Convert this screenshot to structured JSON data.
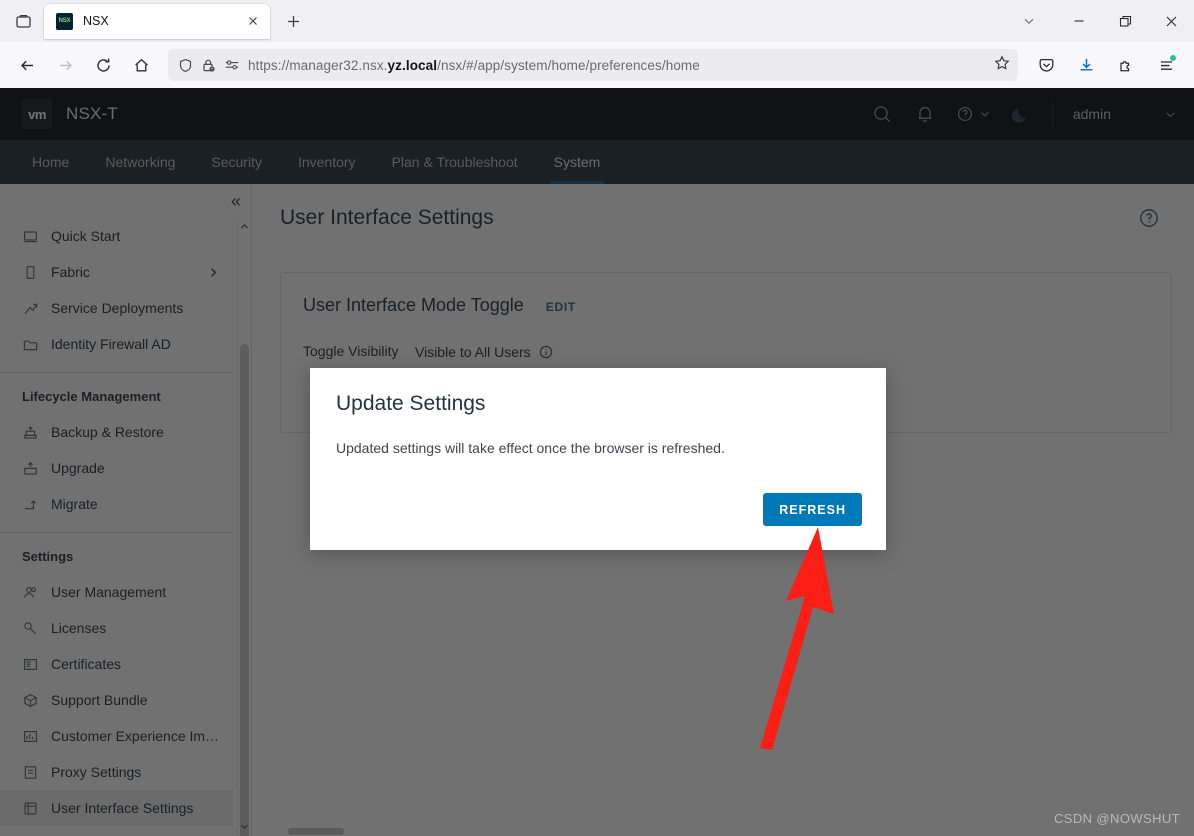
{
  "browser": {
    "tab": {
      "title": "NSX",
      "favicon_text": "NSX"
    },
    "url": {
      "prefix": "https://manager32.nsx.",
      "emphasis": "yz.local",
      "suffix": "/nsx/#/app/system/home/preferences/home"
    },
    "toolbar_icons": [
      "list-all-tabs-icon",
      "close-tab-icon",
      "new-tab-icon",
      "minimize-icon",
      "restore-icon",
      "close-window-icon",
      "back-icon",
      "forward-icon",
      "reload-icon",
      "home-icon",
      "shield-icon",
      "lock-warning-icon",
      "permissions-icon",
      "bookmark-star-icon",
      "pocket-icon",
      "downloads-icon",
      "extensions-icon",
      "app-menu-icon"
    ]
  },
  "app": {
    "logo_text": "vm",
    "name": "NSX-T",
    "user": "admin",
    "header_icons": [
      "search-icon",
      "bell-icon",
      "help-icon",
      "dark-mode-icon"
    ],
    "nav_tabs": [
      {
        "label": "Home",
        "active": false
      },
      {
        "label": "Networking",
        "active": false
      },
      {
        "label": "Security",
        "active": false
      },
      {
        "label": "Inventory",
        "active": false
      },
      {
        "label": "Plan & Troubleshoot",
        "active": false
      },
      {
        "label": "System",
        "active": true
      }
    ]
  },
  "sidebar": {
    "collapse_label": "«",
    "items": [
      {
        "label": "Quick Start",
        "icon": "quick-start-icon",
        "active": false,
        "chevron": false
      },
      {
        "label": "Fabric",
        "icon": "fabric-icon",
        "active": false,
        "chevron": true
      },
      {
        "label": "Service Deployments",
        "icon": "service-deployments-icon",
        "active": false,
        "chevron": false
      },
      {
        "label": "Identity Firewall AD",
        "icon": "identity-firewall-icon",
        "active": false,
        "chevron": false
      }
    ],
    "group_lifecycle": "Lifecycle Management",
    "lifecycle_items": [
      {
        "label": "Backup & Restore",
        "icon": "backup-restore-icon",
        "active": false
      },
      {
        "label": "Upgrade",
        "icon": "upgrade-icon",
        "active": false
      },
      {
        "label": "Migrate",
        "icon": "migrate-icon",
        "active": false
      }
    ],
    "group_settings": "Settings",
    "settings_items": [
      {
        "label": "User Management",
        "icon": "user-management-icon",
        "active": false
      },
      {
        "label": "Licenses",
        "icon": "licenses-icon",
        "active": false
      },
      {
        "label": "Certificates",
        "icon": "certificates-icon",
        "active": false
      },
      {
        "label": "Support Bundle",
        "icon": "support-bundle-icon",
        "active": false
      },
      {
        "label": "Customer Experience Im…",
        "icon": "customer-experience-icon",
        "active": false
      },
      {
        "label": "Proxy Settings",
        "icon": "proxy-settings-icon",
        "active": false
      },
      {
        "label": "User Interface Settings",
        "icon": "ui-settings-icon",
        "active": true
      }
    ]
  },
  "main": {
    "page_title": "User Interface Settings",
    "card": {
      "title": "User Interface Mode Toggle",
      "edit_label": "EDIT",
      "rows": [
        {
          "key": "Toggle Visibility",
          "value": "Visible to All Users",
          "info": true
        }
      ]
    }
  },
  "modal": {
    "title": "Update Settings",
    "body": "Updated settings will take effect once the browser is refreshed.",
    "button_label": "REFRESH",
    "button_color": "#0079b8"
  },
  "annotation": {
    "arrow_color": "#fa1e14"
  },
  "watermark": "CSDN @NOWSHUT"
}
